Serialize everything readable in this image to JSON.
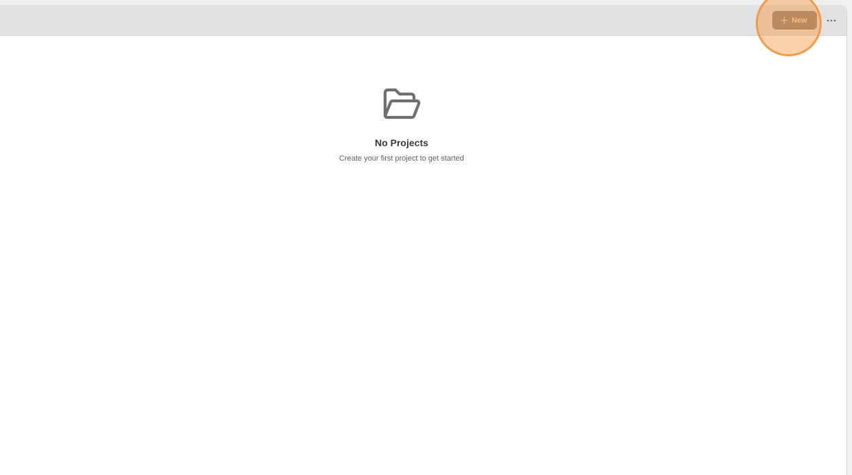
{
  "toolbar": {
    "new_label": "New",
    "new_icon": "plus-icon",
    "more_icon": "more-horizontal-icon",
    "accent_color": "#8d7f79",
    "highlight_color": "#f29a48"
  },
  "empty_state": {
    "icon": "folder-open-icon",
    "title": "No Projects",
    "subtitle": "Create your first project to get started"
  }
}
